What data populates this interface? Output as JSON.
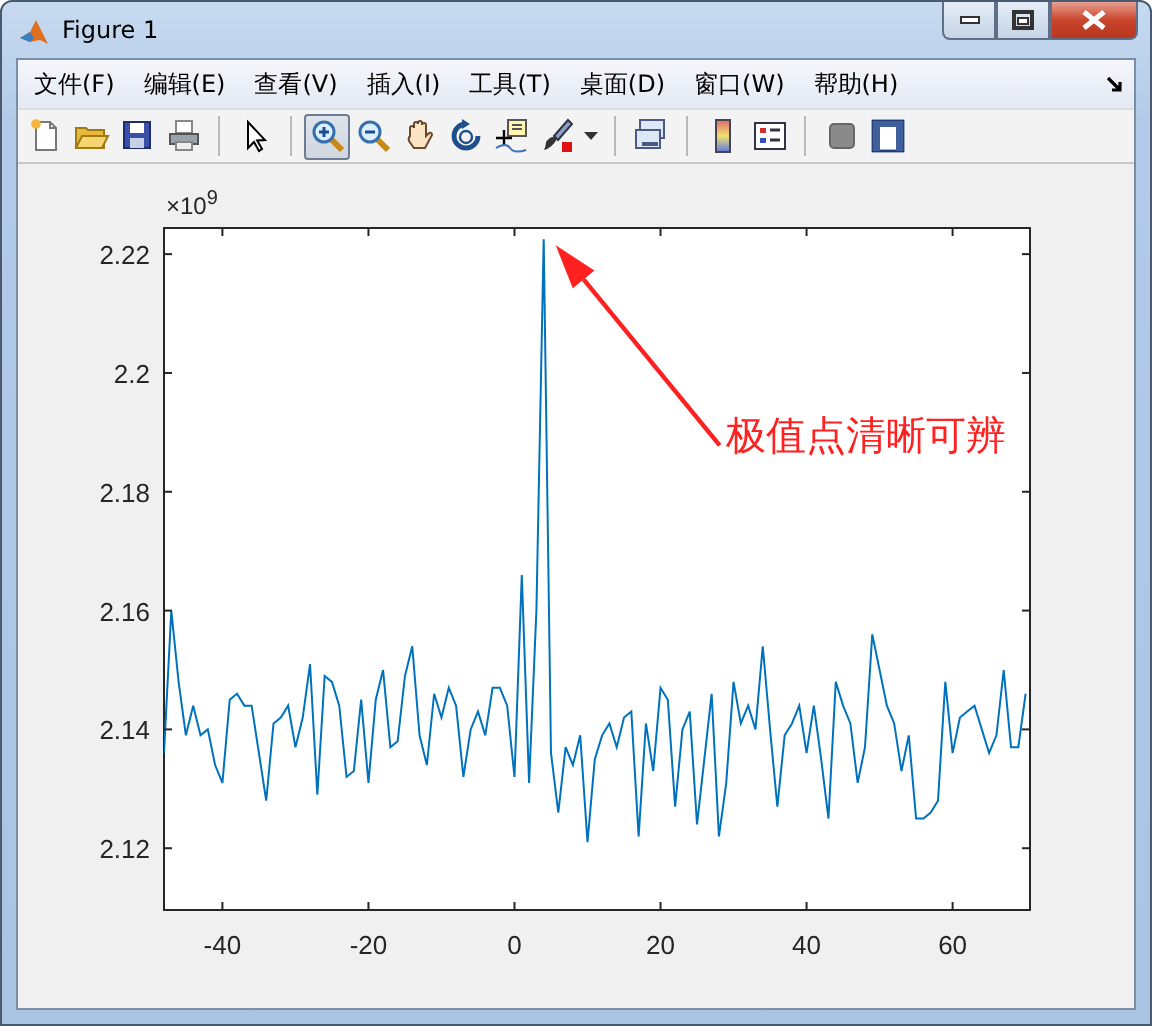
{
  "window": {
    "title": "Figure 1"
  },
  "menu": [
    {
      "label": "文件(F)"
    },
    {
      "label": "编辑(E)"
    },
    {
      "label": "查看(V)"
    },
    {
      "label": "插入(I)"
    },
    {
      "label": "工具(T)"
    },
    {
      "label": "桌面(D)"
    },
    {
      "label": "窗口(W)"
    },
    {
      "label": "帮助(H)"
    }
  ],
  "toolbar": {
    "groups": [
      [
        {
          "kind": "new",
          "selected": false
        },
        {
          "kind": "open",
          "selected": false
        },
        {
          "kind": "save",
          "selected": false
        },
        {
          "kind": "print",
          "selected": false
        }
      ],
      [
        {
          "kind": "pointer",
          "selected": false
        }
      ],
      [
        {
          "kind": "zoomin",
          "selected": true
        },
        {
          "kind": "zoomout",
          "selected": false
        },
        {
          "kind": "pan",
          "selected": false
        },
        {
          "kind": "rotate",
          "selected": false
        },
        {
          "kind": "datacursor",
          "selected": false
        },
        {
          "kind": "brush",
          "selected": false
        }
      ],
      [
        {
          "kind": "link",
          "selected": false
        }
      ],
      [
        {
          "kind": "colorbar",
          "selected": false
        },
        {
          "kind": "legend",
          "selected": false
        }
      ],
      [
        {
          "kind": "hidetools",
          "selected": false
        },
        {
          "kind": "showtools",
          "selected": false
        }
      ]
    ]
  },
  "figure": {
    "exponent_label": "×10$^{9}$",
    "chart_data": {
      "type": "line",
      "x": [
        -48,
        -47,
        -46,
        -45,
        -44,
        -43,
        -42,
        -41,
        -40,
        -39,
        -38,
        -37,
        -36,
        -35,
        -34,
        -33,
        -32,
        -31,
        -30,
        -29,
        -28,
        -27,
        -26,
        -25,
        -24,
        -23,
        -22,
        -21,
        -20,
        -19,
        -18,
        -17,
        -16,
        -15,
        -14,
        -13,
        -12,
        -11,
        -10,
        -9,
        -8,
        -7,
        -6,
        -5,
        -4,
        -3,
        -2,
        -1,
        0,
        1,
        2,
        3,
        4,
        5,
        6,
        7,
        8,
        9,
        10,
        11,
        12,
        13,
        14,
        15,
        16,
        17,
        18,
        19,
        20,
        21,
        22,
        23,
        24,
        25,
        26,
        27,
        28,
        29,
        30,
        31,
        32,
        33,
        34,
        35,
        36,
        37,
        38,
        39,
        40,
        41,
        42,
        43,
        44,
        45,
        46,
        47,
        48,
        49,
        50,
        51,
        52,
        53,
        54,
        55,
        56,
        57,
        58,
        59,
        60,
        61,
        62,
        63,
        64,
        65,
        66,
        67,
        68,
        69,
        70
      ],
      "series": [
        {
          "color": "#0072bd",
          "values": [
            2.136,
            2.16,
            2.148,
            2.139,
            2.144,
            2.139,
            2.14,
            2.134,
            2.131,
            2.145,
            2.146,
            2.144,
            2.144,
            2.136,
            2.128,
            2.141,
            2.142,
            2.144,
            2.137,
            2.142,
            2.151,
            2.129,
            2.149,
            2.148,
            2.144,
            2.132,
            2.133,
            2.145,
            2.131,
            2.145,
            2.15,
            2.137,
            2.138,
            2.149,
            2.154,
            2.139,
            2.134,
            2.146,
            2.142,
            2.147,
            2.144,
            2.132,
            2.14,
            2.143,
            2.139,
            2.147,
            2.147,
            2.144,
            2.132,
            2.166,
            2.131,
            2.16,
            2.2225,
            2.136,
            2.126,
            2.137,
            2.134,
            2.139,
            2.121,
            2.135,
            2.139,
            2.141,
            2.137,
            2.142,
            2.143,
            2.122,
            2.141,
            2.133,
            2.147,
            2.145,
            2.127,
            2.14,
            2.143,
            2.124,
            2.135,
            2.146,
            2.122,
            2.131,
            2.148,
            2.141,
            2.144,
            2.14,
            2.154,
            2.14,
            2.127,
            2.139,
            2.141,
            2.144,
            2.136,
            2.144,
            2.135,
            2.125,
            2.148,
            2.144,
            2.141,
            2.131,
            2.137,
            2.156,
            2.15,
            2.144,
            2.141,
            2.133,
            2.139,
            2.125,
            2.125,
            2.126,
            2.128,
            2.148,
            2.136,
            2.142,
            2.143,
            2.144,
            2.14,
            2.136,
            2.139,
            2.15,
            2.137,
            2.137,
            2.146
          ]
        }
      ],
      "xlim": [
        -48,
        70.6
      ],
      "ylim": [
        2.1096,
        2.2244
      ],
      "xticks": [
        -40,
        -20,
        0,
        20,
        40,
        60
      ],
      "yticks": [
        2.12,
        2.14,
        2.16,
        2.18,
        2.2,
        2.22
      ]
    },
    "callout": {
      "text": "极值点清晰可辨",
      "color": "#ff2020"
    }
  }
}
